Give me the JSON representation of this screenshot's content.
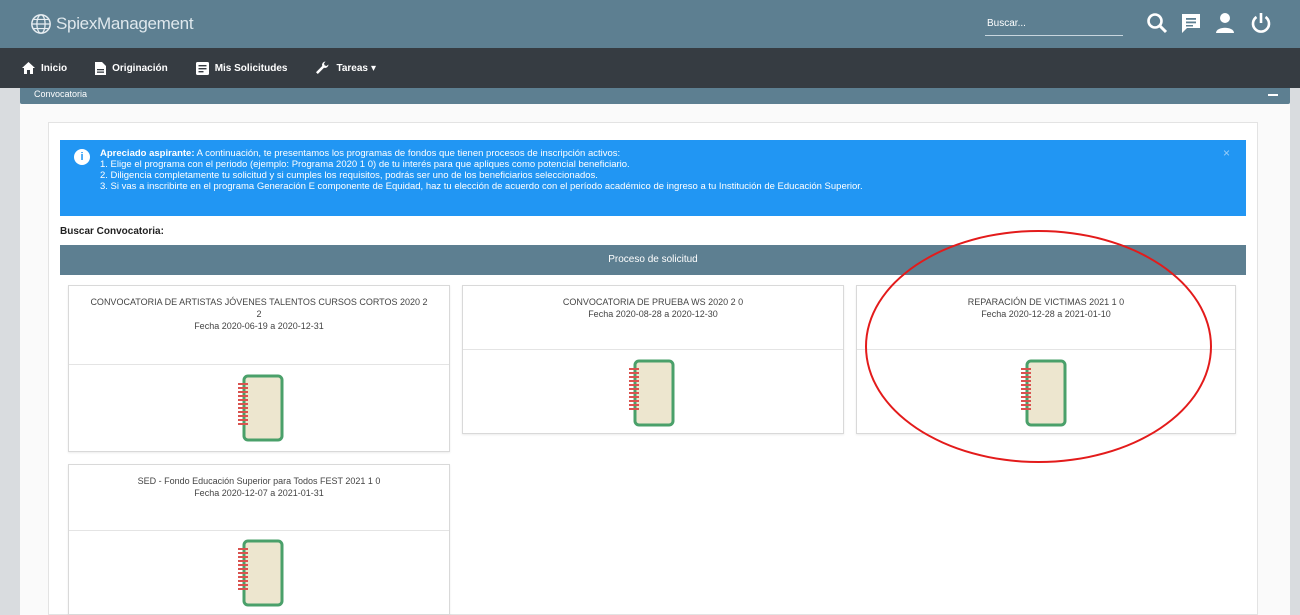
{
  "app": {
    "brand": "SpiexManagement"
  },
  "search": {
    "placeholder": "Buscar..."
  },
  "nav": {
    "items": [
      {
        "label": "Inicio",
        "icon": "home-icon"
      },
      {
        "label": "Originación",
        "icon": "document-icon"
      },
      {
        "label": "Mis Solicitudes",
        "icon": "form-icon"
      },
      {
        "label": "Tareas",
        "icon": "wrench-icon"
      }
    ],
    "dropdown_glyph": "▾"
  },
  "panel": {
    "title": "Convocatoria"
  },
  "alert": {
    "lead": "Apreciado aspirante:",
    "intro": "A continuación, te presentamos los programas de fondos que tienen procesos de inscripción activos:",
    "line1": "1. Elige el programa con el periodo (ejemplo: Programa 2020 1 0) de tu interés para que apliques como potencial beneficiario.",
    "line2": "2. Diligencia completamente tu solicitud y si cumples los requisitos, podrás ser uno de los beneficiarios seleccionados.",
    "line3": "3. Si vas a inscribirte en el programa Generación E componente de Equidad, haz tu elección de acuerdo con el período académico de ingreso a tu Institución de Educación Superior.",
    "close": "×"
  },
  "search_label": "Buscar Convocatoria:",
  "section_header": "Proceso de solicitud",
  "cards": [
    {
      "title": "CONVOCATORIA DE ARTISTAS JÓVENES TALENTOS CURSOS CORTOS 2020 2 2",
      "date": "Fecha 2020-06-19 a 2020-12-31"
    },
    {
      "title": "CONVOCATORIA DE PRUEBA WS 2020 2 0",
      "date": "Fecha 2020-08-28 a 2020-12-30"
    },
    {
      "title": "REPARACIÓN DE VICTIMAS 2021 1 0",
      "date": "Fecha 2020-12-28 a 2021-01-10"
    },
    {
      "title": "SED - Fondo Educación Superior para Todos FEST 2021 1 0",
      "date": "Fecha 2020-12-07 a 2021-01-31"
    }
  ],
  "colors": {
    "header": "#5d7f91",
    "nav": "#363c42",
    "alert": "#2196f3",
    "annotation": "#e31b1b",
    "notebook_cover": "#ede6cf",
    "notebook_border": "#4aa06a",
    "notebook_rings": "#d9534f"
  }
}
